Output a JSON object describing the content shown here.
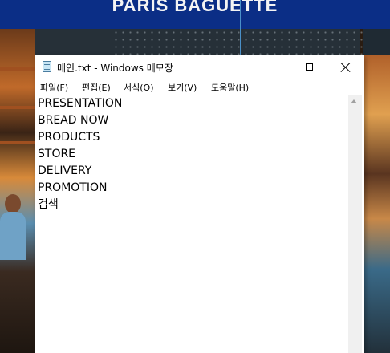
{
  "background": {
    "brand": "PARIS BAGUETTE"
  },
  "window": {
    "title": "메인.txt - Windows 메모장",
    "icon": "notepad-icon"
  },
  "menu": {
    "items": [
      "파일(F)",
      "편집(E)",
      "서식(O)",
      "보기(V)",
      "도움말(H)"
    ]
  },
  "editor": {
    "lines": [
      "PRESENTATION",
      "BREAD NOW",
      "PRODUCTS",
      "STORE",
      "DELIVERY",
      "PROMOTION",
      "검색"
    ]
  },
  "colors": {
    "header_blue": "#0b2e86",
    "window_bg": "#ffffff"
  }
}
